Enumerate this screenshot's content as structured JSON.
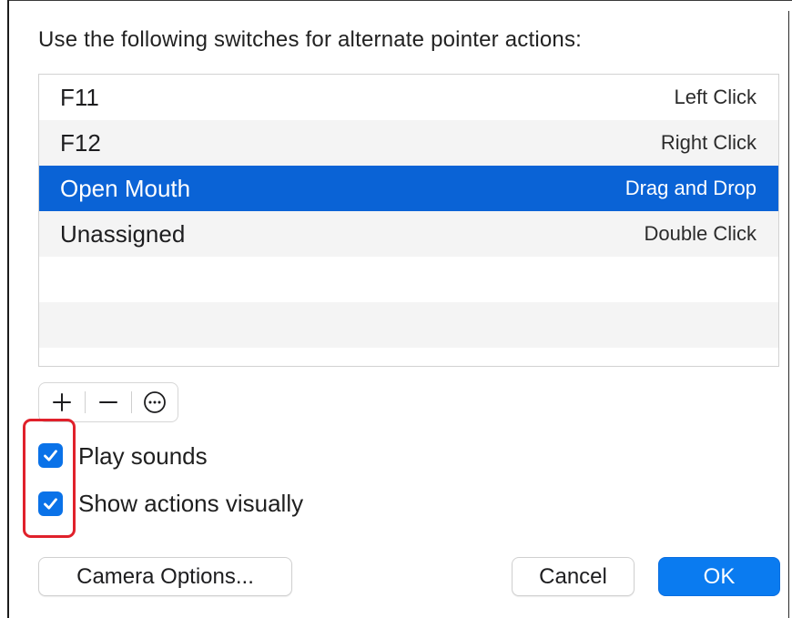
{
  "dialog": {
    "instruction": "Use the following switches for alternate pointer actions:"
  },
  "switch_list": {
    "rows": [
      {
        "switch": "F11",
        "action": "Left Click",
        "selected": false
      },
      {
        "switch": "F12",
        "action": "Right Click",
        "selected": false
      },
      {
        "switch": "Open Mouth",
        "action": "Drag and Drop",
        "selected": true
      },
      {
        "switch": "Unassigned",
        "action": "Double Click",
        "selected": false
      }
    ]
  },
  "list_controls": {
    "add_icon": "plus-icon",
    "remove_icon": "minus-icon",
    "more_icon": "ellipsis-circle-icon"
  },
  "options": {
    "play_sounds": {
      "label": "Play sounds",
      "checked": true
    },
    "show_actions": {
      "label": "Show actions visually",
      "checked": true
    }
  },
  "buttons": {
    "camera_options": "Camera Options...",
    "cancel": "Cancel",
    "ok": "OK"
  },
  "colors": {
    "selection": "#0a63d6",
    "accent": "#0a7bf0",
    "highlight_box": "#e0212b"
  }
}
